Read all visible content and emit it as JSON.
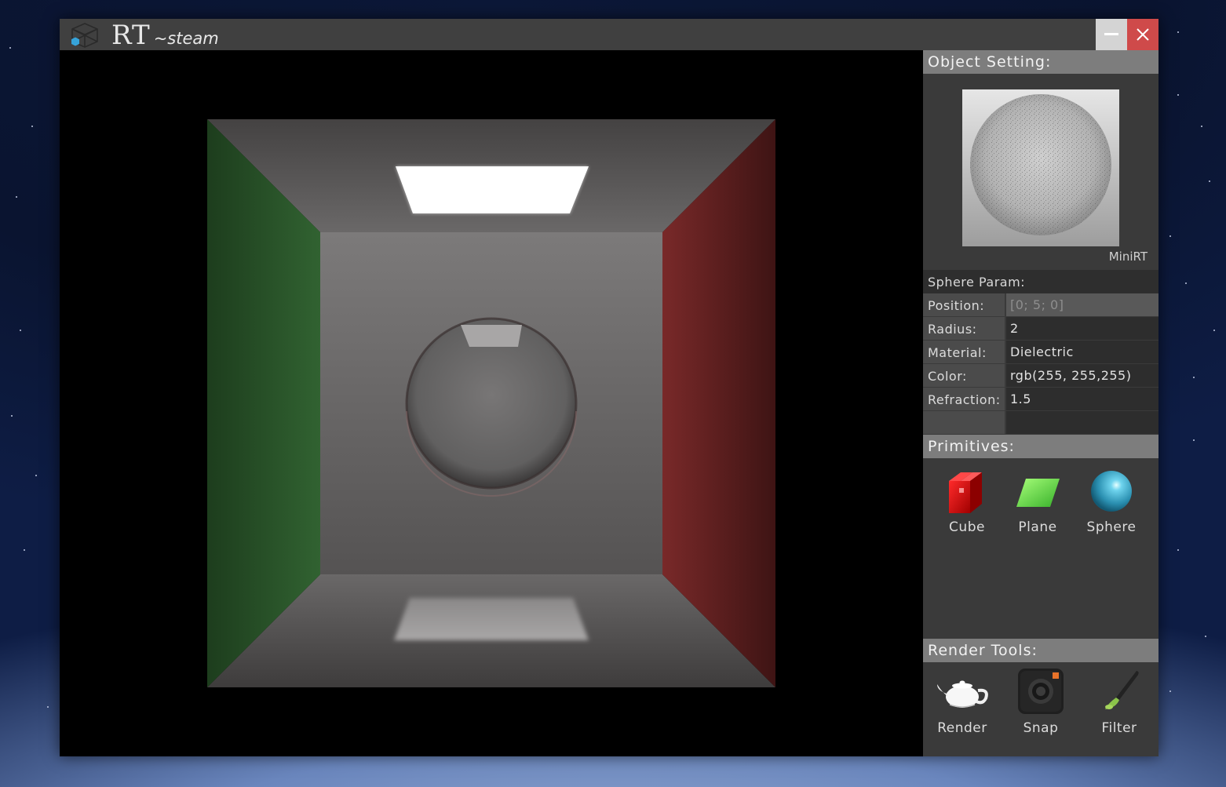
{
  "app": {
    "title_main": "RT",
    "title_sub": "~steam",
    "logo_icon": "cube-logo-icon",
    "minimize_icon": "minimize-icon",
    "close_icon": "close-icon"
  },
  "panel": {
    "object_setting": {
      "title": "Object Setting:",
      "preview_caption": "MiniRT"
    },
    "sphere_param": {
      "title": "Sphere Param:",
      "rows": [
        {
          "label": "Position:",
          "value": "",
          "placeholder": "[0; 5; 0]"
        },
        {
          "label": "Radius:",
          "value": "2"
        },
        {
          "label": "Material:",
          "value": "Dielectric"
        },
        {
          "label": "Color:",
          "value": "rgb(255, 255,255)"
        },
        {
          "label": "Refraction:",
          "value": "1.5"
        },
        {
          "label": "",
          "value": ""
        }
      ]
    },
    "primitives": {
      "title": "Primitives:",
      "items": [
        {
          "label": "Cube",
          "icon": "red-cube-icon"
        },
        {
          "label": "Plane",
          "icon": "green-plane-icon"
        },
        {
          "label": "Sphere",
          "icon": "blue-sphere-icon"
        }
      ]
    },
    "render_tools": {
      "title": "Render Tools:",
      "items": [
        {
          "label": "Render",
          "icon": "teapot-icon"
        },
        {
          "label": "Snap",
          "icon": "camera-icon"
        },
        {
          "label": "Filter",
          "icon": "paintbrush-icon"
        }
      ]
    }
  },
  "colors": {
    "titlebar": "#404040",
    "close_button": "#cf4a4a",
    "minimize_button": "#d4d4d4",
    "section_header": "#7d7d7d",
    "panel_bg": "#3a3a3a",
    "left_wall": "#2c5a2c",
    "right_wall": "#6e2424"
  }
}
